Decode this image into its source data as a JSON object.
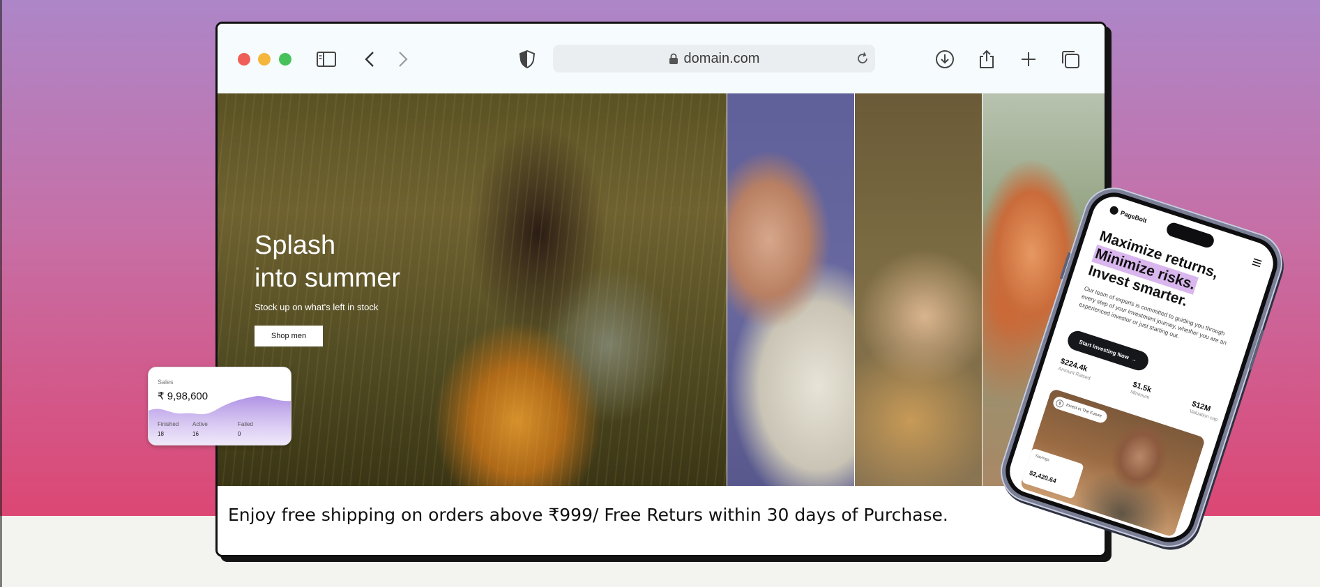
{
  "browser": {
    "url": "domain.com",
    "icons": [
      "sidebar-icon",
      "back-icon",
      "forward-icon",
      "shield-icon",
      "lock-icon",
      "reload-icon",
      "download-icon",
      "share-icon",
      "new-tab-icon",
      "tabs-overview-icon"
    ]
  },
  "hero": {
    "title_line1": "Splash",
    "title_line2": "into summer",
    "subtitle": "Stock up on what's left in stock",
    "button_label": "Shop men"
  },
  "banner": {
    "shipping_text": "Enjoy free shipping on orders above ₹999/ Free Returs within 30 days of Purchase."
  },
  "sales_card": {
    "label": "Sales",
    "value": "₹ 9,98,600",
    "stats": [
      {
        "label": "Finished",
        "value": "18"
      },
      {
        "label": "Active",
        "value": "16"
      },
      {
        "label": "Failed",
        "value": "0"
      }
    ]
  },
  "phone": {
    "brand": "PageBolt",
    "headline_line1": "Maximize returns,",
    "headline_line2": "Minimize risks.",
    "headline_line3": "Invest smarter.",
    "paragraph": "Our team of experts is committed to guiding you through every step of your investment journey, whether you are an experienced investor or just starting out.",
    "cta_label": "Start Investing Now",
    "stats": [
      {
        "value": "$224.4k",
        "label": "Amount Raised"
      },
      {
        "value": "$1.5k",
        "label": "Minimum"
      },
      {
        "value": "$12M",
        "label": "Valuation cap"
      }
    ],
    "chip_label": "Invest in The Future",
    "savings_label": "Savings",
    "savings_value": "$2,420.64"
  },
  "colors": {
    "background_top": "#ad86c8",
    "background_bottom": "#dc4774",
    "highlight": "#d9b6ee",
    "accent_wave": "#b18ae0"
  }
}
